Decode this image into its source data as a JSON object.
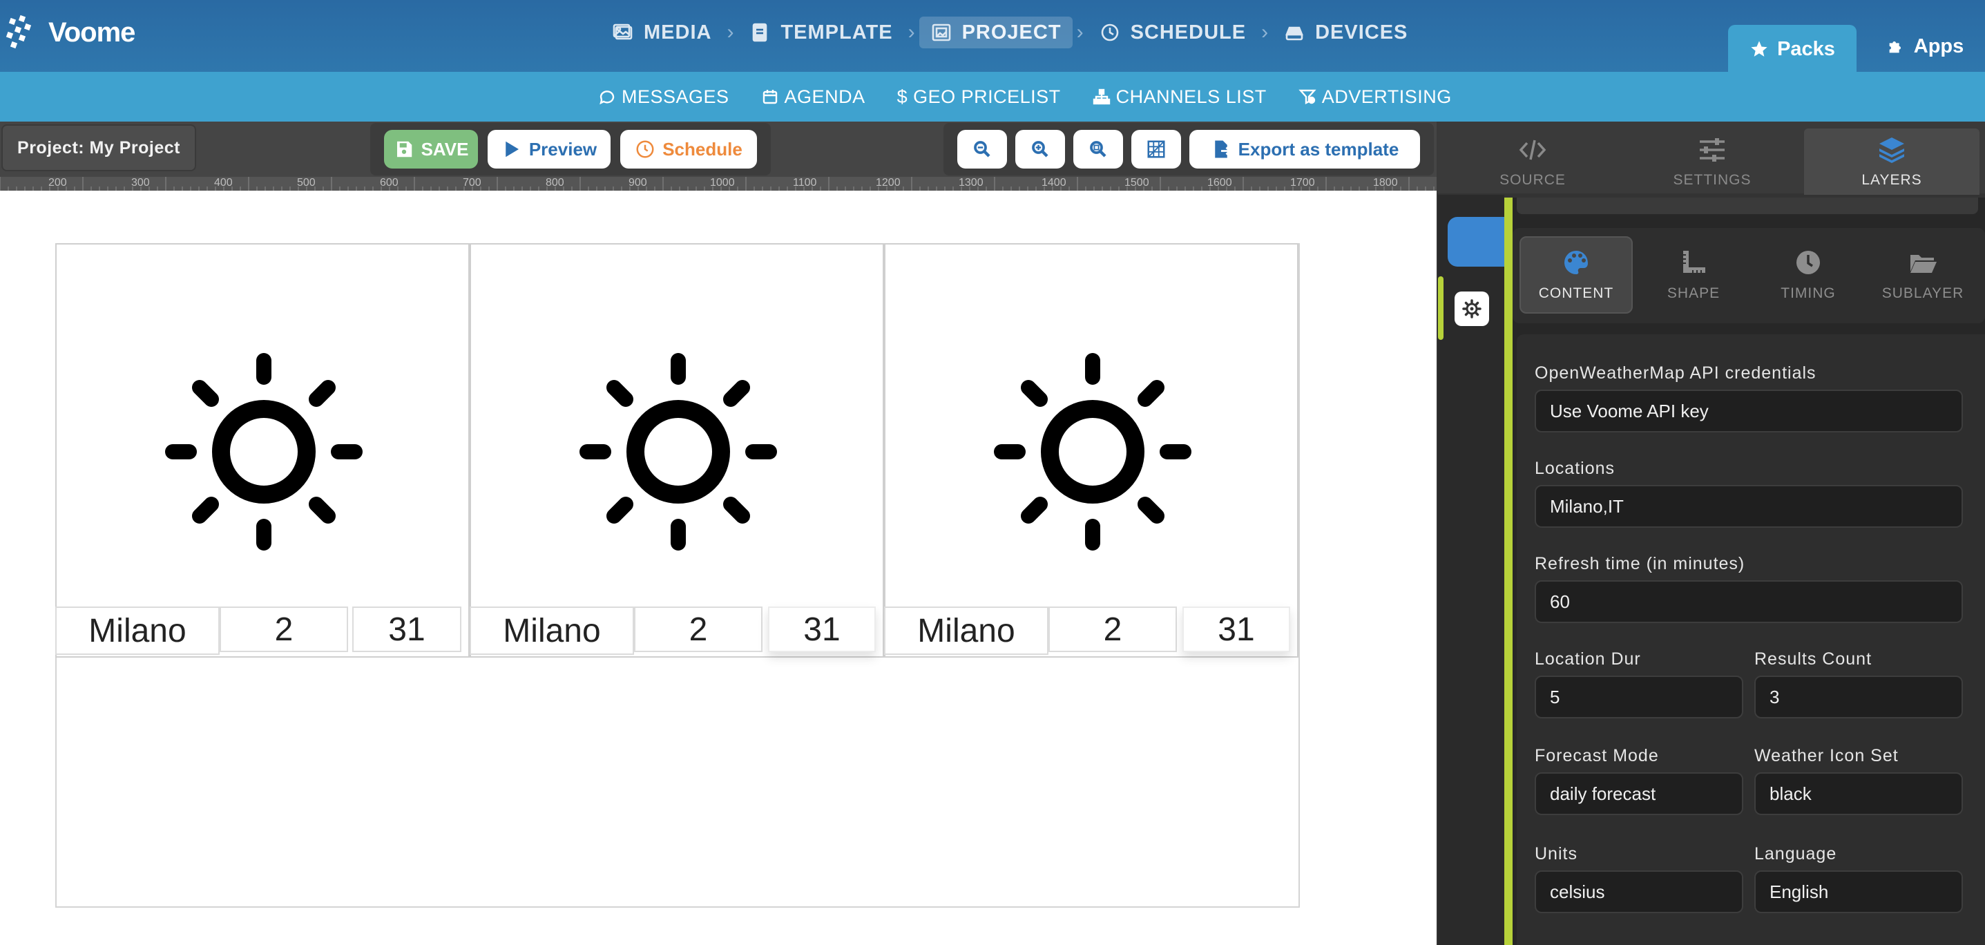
{
  "app": {
    "brand": "Voome",
    "accent": "#3fa2cf",
    "primary": "#2a6aa3"
  },
  "wizard_steps": [
    {
      "label": "MEDIA",
      "icon": "image-icon",
      "active": false
    },
    {
      "label": "TEMPLATE",
      "icon": "document-icon",
      "active": false
    },
    {
      "label": "PROJECT",
      "icon": "project-icon",
      "active": true
    },
    {
      "label": "SCHEDULE",
      "icon": "clock-icon",
      "active": false
    },
    {
      "label": "DEVICES",
      "icon": "device-icon",
      "active": false
    }
  ],
  "top_tabs": {
    "packs": "Packs",
    "apps": "Apps"
  },
  "subnav": [
    {
      "label": "MESSAGES",
      "icon": "chat-icon"
    },
    {
      "label": "AGENDA",
      "icon": "calendar-icon"
    },
    {
      "label": "GEO PRICELIST",
      "icon": "dollar-icon"
    },
    {
      "label": "CHANNELS LIST",
      "icon": "sitemap-icon"
    },
    {
      "label": "ADVERTISING",
      "icon": "ad-icon"
    }
  ],
  "toolbar": {
    "project_label": "Project: My Project",
    "save": "SAVE",
    "preview": "Preview",
    "schedule": "Schedule",
    "export": "Export as template",
    "zoom_buttons": [
      "zoom-out-icon",
      "zoom-in-icon",
      "zoom-fit-icon",
      "grid-icon"
    ]
  },
  "ruler": [
    "200",
    "300",
    "400",
    "500",
    "600",
    "700",
    "800",
    "900",
    "1000",
    "1100",
    "1200",
    "1300",
    "1400",
    "1500",
    "1600",
    "1700",
    "1800"
  ],
  "weather_cards": [
    {
      "city": "Milano",
      "day": "2",
      "value": "31",
      "icon": "sun-icon"
    },
    {
      "city": "Milano",
      "day": "2",
      "value": "31",
      "icon": "sun-icon"
    },
    {
      "city": "Milano",
      "day": "2",
      "value": "31",
      "icon": "sun-icon"
    }
  ],
  "right_tabs": [
    {
      "label": "SOURCE",
      "icon": "code-icon",
      "active": false
    },
    {
      "label": "SETTINGS",
      "icon": "sliders-icon",
      "active": false
    },
    {
      "label": "LAYERS",
      "icon": "layers-icon",
      "active": true
    }
  ],
  "layer_tabs": [
    {
      "label": "CONTENT",
      "icon": "palette-icon",
      "active": true
    },
    {
      "label": "SHAPE",
      "icon": "ruler-icon",
      "active": false
    },
    {
      "label": "TIMING",
      "icon": "clock-icon",
      "active": false
    },
    {
      "label": "SUBLAYER",
      "icon": "folder-icon",
      "active": false
    }
  ],
  "form": {
    "credentials": {
      "label": "OpenWeatherMap API credentials",
      "value": "Use Voome API key"
    },
    "locations": {
      "label": "Locations",
      "value": "Milano,IT"
    },
    "refresh": {
      "label": "Refresh time (in minutes)",
      "value": "60"
    },
    "location_dur": {
      "label": "Location Dur",
      "value": "5"
    },
    "results_count": {
      "label": "Results Count",
      "value": "3"
    },
    "forecast_mode": {
      "label": "Forecast Mode",
      "value": "daily forecast"
    },
    "icon_set": {
      "label": "Weather Icon Set",
      "value": "black"
    },
    "units": {
      "label": "Units",
      "value": "celsius"
    },
    "language": {
      "label": "Language",
      "value": "English"
    }
  }
}
